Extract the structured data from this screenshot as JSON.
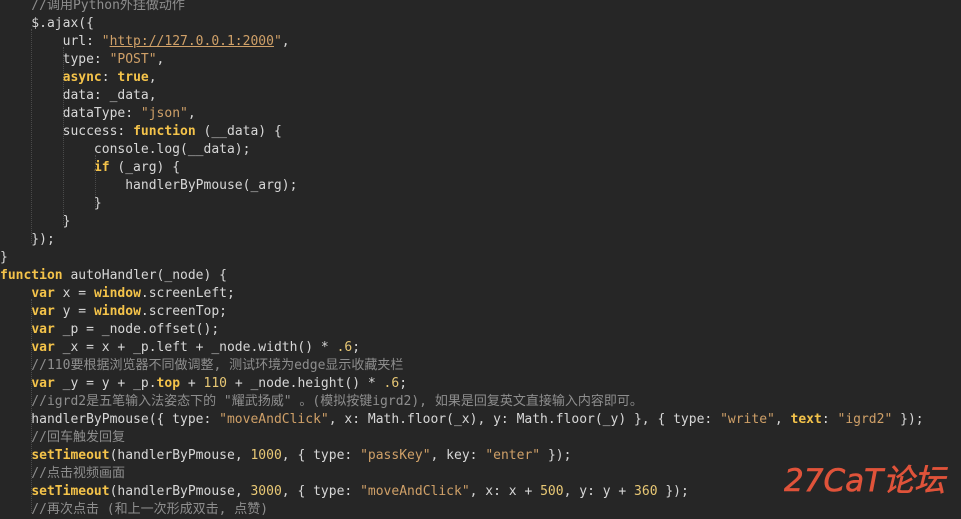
{
  "colors": {
    "background": "#262626",
    "text": "#d7d7d7",
    "keyword": "#f4c34a",
    "string": "#cfa068",
    "number": "#e8c875",
    "comment": "#8e8e8e",
    "watermark": "#e0533a"
  },
  "code": {
    "lines": [
      [
        {
          "t": "    //调用Python外挂做动作",
          "c": "cmt"
        }
      ],
      [
        {
          "t": "    $.ajax({",
          "c": "plain"
        }
      ],
      [
        {
          "t": "        url: ",
          "c": "plain"
        },
        {
          "t": "\"",
          "c": "str"
        },
        {
          "t": "http://127.0.0.1:2000",
          "c": "url"
        },
        {
          "t": "\"",
          "c": "str"
        },
        {
          "t": ",",
          "c": "plain"
        }
      ],
      [
        {
          "t": "        type: ",
          "c": "plain"
        },
        {
          "t": "\"POST\"",
          "c": "str"
        },
        {
          "t": ",",
          "c": "plain"
        }
      ],
      [
        {
          "t": "        ",
          "c": "plain"
        },
        {
          "t": "async",
          "c": "kw"
        },
        {
          "t": ": ",
          "c": "plain"
        },
        {
          "t": "true",
          "c": "kw"
        },
        {
          "t": ",",
          "c": "plain"
        }
      ],
      [
        {
          "t": "        data: _data,",
          "c": "plain"
        }
      ],
      [
        {
          "t": "        dataType: ",
          "c": "plain"
        },
        {
          "t": "\"json\"",
          "c": "str"
        },
        {
          "t": ",",
          "c": "plain"
        }
      ],
      [
        {
          "t": "        success: ",
          "c": "plain"
        },
        {
          "t": "function",
          "c": "kw"
        },
        {
          "t": " (__data) {",
          "c": "plain"
        }
      ],
      [
        {
          "t": "            console.log(__data);",
          "c": "plain"
        }
      ],
      [
        {
          "t": "            ",
          "c": "plain"
        },
        {
          "t": "if",
          "c": "kw"
        },
        {
          "t": " (_arg) {",
          "c": "plain"
        }
      ],
      [
        {
          "t": "                handlerByPmouse(_arg);",
          "c": "plain"
        }
      ],
      [
        {
          "t": "            }",
          "c": "plain"
        }
      ],
      [
        {
          "t": "        }",
          "c": "plain"
        }
      ],
      [
        {
          "t": "    });",
          "c": "plain"
        }
      ],
      [
        {
          "t": "}",
          "c": "plain"
        }
      ],
      [
        {
          "t": "function",
          "c": "kw"
        },
        {
          "t": " autoHandler(_node) {",
          "c": "plain"
        }
      ],
      [
        {
          "t": "    ",
          "c": "plain"
        },
        {
          "t": "var",
          "c": "kw"
        },
        {
          "t": " x = ",
          "c": "plain"
        },
        {
          "t": "window",
          "c": "kw"
        },
        {
          "t": ".screenLeft;",
          "c": "plain"
        }
      ],
      [
        {
          "t": "    ",
          "c": "plain"
        },
        {
          "t": "var",
          "c": "kw"
        },
        {
          "t": " y = ",
          "c": "plain"
        },
        {
          "t": "window",
          "c": "kw"
        },
        {
          "t": ".screenTop;",
          "c": "plain"
        }
      ],
      [
        {
          "t": "    ",
          "c": "plain"
        },
        {
          "t": "var",
          "c": "kw"
        },
        {
          "t": " _p = _node.offset();",
          "c": "plain"
        }
      ],
      [
        {
          "t": "    ",
          "c": "plain"
        },
        {
          "t": "var",
          "c": "kw"
        },
        {
          "t": " _x = x + _p.left + _node.width() * ",
          "c": "plain"
        },
        {
          "t": ".6",
          "c": "num"
        },
        {
          "t": ";",
          "c": "plain"
        }
      ],
      [
        {
          "t": "    //110要根据浏览器不同做调整, 测试环境为edge显示收藏夹栏",
          "c": "cmt"
        }
      ],
      [
        {
          "t": "    ",
          "c": "plain"
        },
        {
          "t": "var",
          "c": "kw"
        },
        {
          "t": " _y = y + _p.",
          "c": "plain"
        },
        {
          "t": "top",
          "c": "kw"
        },
        {
          "t": " + ",
          "c": "plain"
        },
        {
          "t": "110",
          "c": "num"
        },
        {
          "t": " + _node.height() * ",
          "c": "plain"
        },
        {
          "t": ".6",
          "c": "num"
        },
        {
          "t": ";",
          "c": "plain"
        }
      ],
      [
        {
          "t": "    //igrd2是五笔输入法姿态下的 \"耀武扬威\" 。(模拟按键igrd2), 如果是回复英文直接输入内容即可。",
          "c": "cmt"
        }
      ],
      [
        {
          "t": "    handlerByPmouse({ type: ",
          "c": "plain"
        },
        {
          "t": "\"moveAndClick\"",
          "c": "str"
        },
        {
          "t": ", x: Math.floor(_x), y: Math.floor(_y) }, { type: ",
          "c": "plain"
        },
        {
          "t": "\"write\"",
          "c": "str"
        },
        {
          "t": ", ",
          "c": "plain"
        },
        {
          "t": "text",
          "c": "kw"
        },
        {
          "t": ": ",
          "c": "plain"
        },
        {
          "t": "\"igrd2\"",
          "c": "str"
        },
        {
          "t": " });",
          "c": "plain"
        }
      ],
      [
        {
          "t": "    //回车触发回复",
          "c": "cmt"
        }
      ],
      [
        {
          "t": "    ",
          "c": "plain"
        },
        {
          "t": "setTimeout",
          "c": "kw"
        },
        {
          "t": "(handlerByPmouse, ",
          "c": "plain"
        },
        {
          "t": "1000",
          "c": "num"
        },
        {
          "t": ", { type: ",
          "c": "plain"
        },
        {
          "t": "\"passKey\"",
          "c": "str"
        },
        {
          "t": ", key: ",
          "c": "plain"
        },
        {
          "t": "\"enter\"",
          "c": "str"
        },
        {
          "t": " });",
          "c": "plain"
        }
      ],
      [
        {
          "t": "    //点击视频画面",
          "c": "cmt"
        }
      ],
      [
        {
          "t": "    ",
          "c": "plain"
        },
        {
          "t": "setTimeout",
          "c": "kw"
        },
        {
          "t": "(handlerByPmouse, ",
          "c": "plain"
        },
        {
          "t": "3000",
          "c": "num"
        },
        {
          "t": ", { type: ",
          "c": "plain"
        },
        {
          "t": "\"moveAndClick\"",
          "c": "str"
        },
        {
          "t": ", x: x + ",
          "c": "plain"
        },
        {
          "t": "500",
          "c": "num"
        },
        {
          "t": ", y: y + ",
          "c": "plain"
        },
        {
          "t": "360",
          "c": "num"
        },
        {
          "t": " });",
          "c": "plain"
        }
      ],
      [
        {
          "t": "    //再次点击 (和上一次形成双击, 点赞)",
          "c": "cmt"
        }
      ]
    ]
  },
  "watermark": {
    "text": "27CaT论坛"
  }
}
